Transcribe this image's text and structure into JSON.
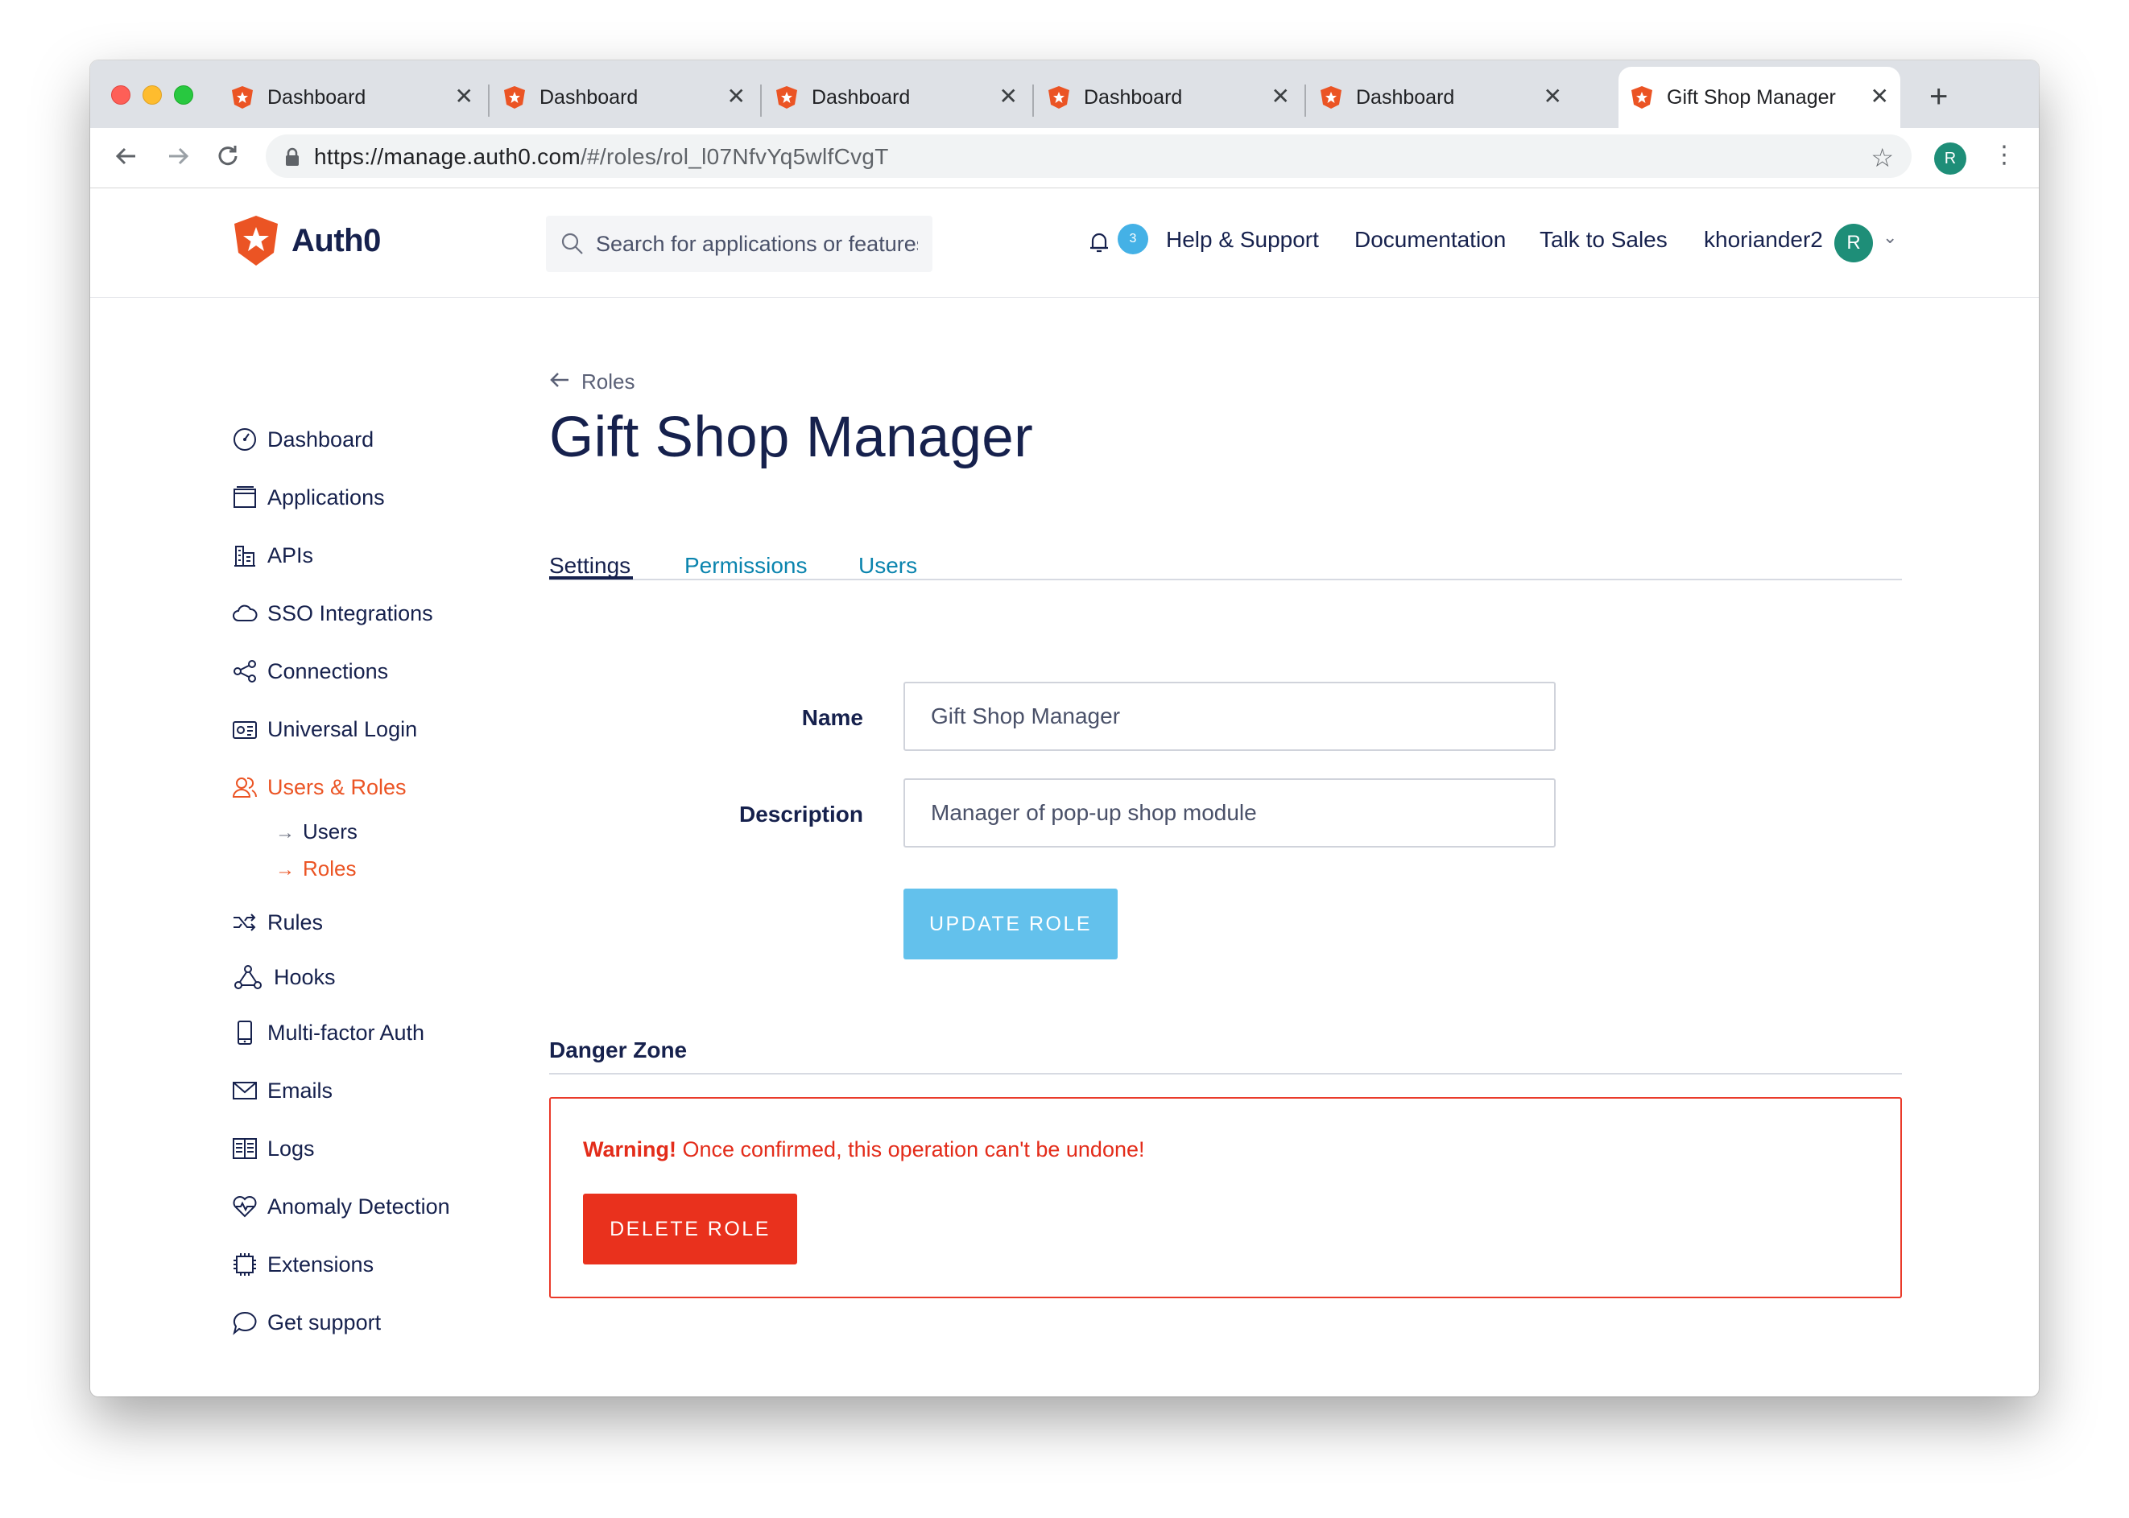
{
  "browser": {
    "tabs": [
      {
        "title": "Dashboard"
      },
      {
        "title": "Dashboard"
      },
      {
        "title": "Dashboard"
      },
      {
        "title": "Dashboard"
      },
      {
        "title": "Dashboard"
      },
      {
        "title": "Gift Shop Manager"
      }
    ],
    "active_tab_index": 5,
    "close_glyph": "✕",
    "new_tab_glyph": "+",
    "url_host": "https://manage.auth0.com",
    "url_path": "/#/roles/rol_l07NfvYq5wlfCvgT",
    "profile_initial": "R"
  },
  "header": {
    "brand": "Auth0",
    "search_placeholder": "Search for applications or features",
    "notification_count": "3",
    "links": {
      "help": "Help & Support",
      "docs": "Documentation",
      "sales": "Talk to Sales"
    },
    "username": "khoriander2",
    "avatar_initial": "R"
  },
  "sidebar": {
    "items": [
      {
        "label": "Dashboard",
        "icon": "gauge-icon"
      },
      {
        "label": "Applications",
        "icon": "browser-window-icon"
      },
      {
        "label": "APIs",
        "icon": "buildings-icon"
      },
      {
        "label": "SSO Integrations",
        "icon": "cloud-icon"
      },
      {
        "label": "Connections",
        "icon": "share-nodes-icon"
      },
      {
        "label": "Universal Login",
        "icon": "id-card-icon"
      },
      {
        "label": "Users & Roles",
        "icon": "users-icon",
        "active": true
      },
      {
        "label": "Rules",
        "icon": "shuffle-icon"
      },
      {
        "label": "Hooks",
        "icon": "hooks-icon"
      },
      {
        "label": "Multi-factor Auth",
        "icon": "phone-icon"
      },
      {
        "label": "Emails",
        "icon": "envelope-icon"
      },
      {
        "label": "Logs",
        "icon": "book-icon"
      },
      {
        "label": "Anomaly Detection",
        "icon": "heart-pulse-icon"
      },
      {
        "label": "Extensions",
        "icon": "chip-icon"
      },
      {
        "label": "Get support",
        "icon": "chat-bubble-icon"
      }
    ],
    "sub_items": [
      {
        "label": "Users"
      },
      {
        "label": "Roles",
        "active": true
      }
    ]
  },
  "main": {
    "breadcrumb": "Roles",
    "title": "Gift Shop Manager",
    "tabs": [
      {
        "label": "Settings",
        "active": true
      },
      {
        "label": "Permissions"
      },
      {
        "label": "Users"
      }
    ],
    "form": {
      "name_label": "Name",
      "name_value": "Gift Shop Manager",
      "description_label": "Description",
      "description_value": "Manager of pop-up shop module",
      "update_button": "UPDATE ROLE"
    },
    "danger_zone": {
      "heading": "Danger Zone",
      "warning_strong": "Warning!",
      "warning_text": " Once confirmed, this operation can't be undone!",
      "delete_button": "DELETE ROLE"
    }
  },
  "colors": {
    "brand_orange": "#eb5424",
    "navy_text": "#16214d",
    "link_blue": "#0a84ae",
    "update_button": "#63c1ec",
    "danger_red": "#e9311d",
    "avatar_green": "#1e8e78"
  }
}
